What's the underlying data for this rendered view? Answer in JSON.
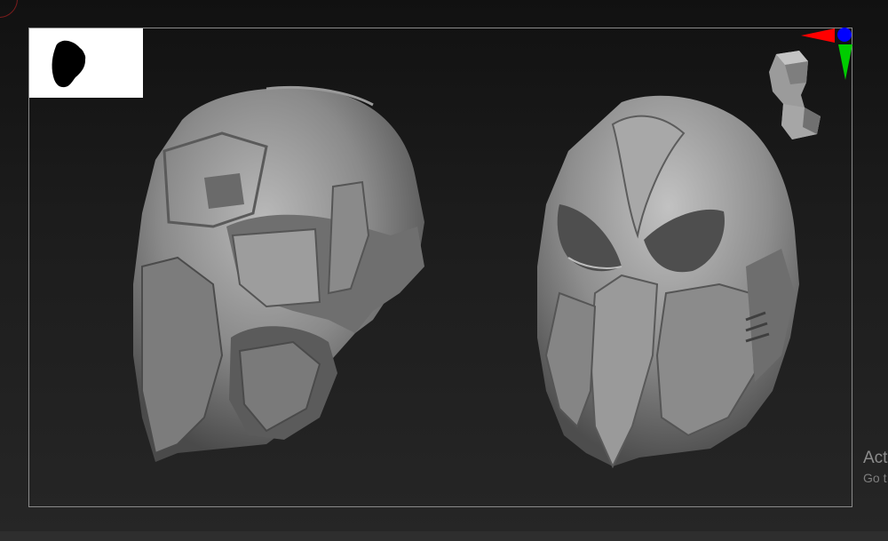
{
  "canvas": {
    "background_top": "#111111",
    "background_bottom": "#262626",
    "frame_color": "#8a8a8a"
  },
  "thumbnail": {
    "background": "#ffffff",
    "silhouette_color": "#000000"
  },
  "axis_gizmo": {
    "x_color": "#ff0000",
    "y_color": "#00cc00",
    "z_color": "#0000ff"
  },
  "models": {
    "color": "#8e8e8e",
    "items": [
      "helmet-left",
      "helmet-right"
    ]
  },
  "watermark": {
    "line1": "Act",
    "line2": "Go t"
  }
}
